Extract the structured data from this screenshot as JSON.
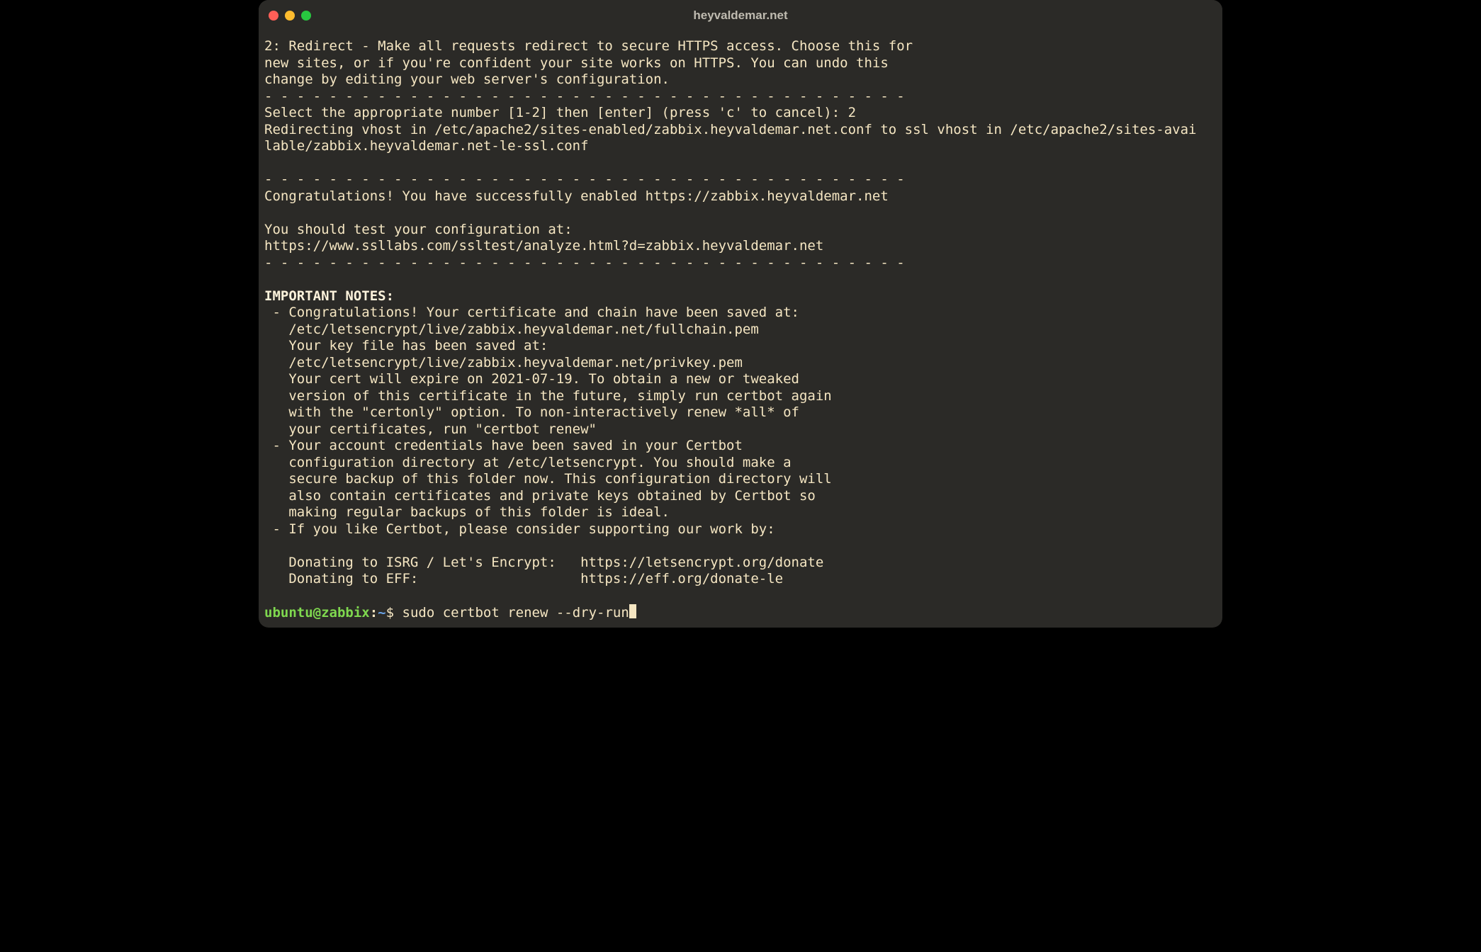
{
  "window": {
    "title": "heyvaldemar.net"
  },
  "output": {
    "l1": "2: Redirect - Make all requests redirect to secure HTTPS access. Choose this for",
    "l2": "new sites, or if you're confident your site works on HTTPS. You can undo this",
    "l3": "change by editing your web server's configuration.",
    "dash1": "- - - - - - - - - - - - - - - - - - - - - - - - - - - - - - - - - - - - - - - -",
    "l4": "Select the appropriate number [1-2] then [enter] (press 'c' to cancel): 2",
    "l5": "Redirecting vhost in /etc/apache2/sites-enabled/zabbix.heyvaldemar.net.conf to ssl vhost in /etc/apache2/sites-avai",
    "l6": "lable/zabbix.heyvaldemar.net-le-ssl.conf",
    "blank1": "",
    "dash2": "- - - - - - - - - - - - - - - - - - - - - - - - - - - - - - - - - - - - - - - -",
    "l7": "Congratulations! You have successfully enabled https://zabbix.heyvaldemar.net",
    "blank2": "",
    "l8": "You should test your configuration at:",
    "l9": "https://www.ssllabs.com/ssltest/analyze.html?d=zabbix.heyvaldemar.net",
    "dash3": "- - - - - - - - - - - - - - - - - - - - - - - - - - - - - - - - - - - - - - - -",
    "blank3": "",
    "l10": "IMPORTANT NOTES:",
    "l11": " - Congratulations! Your certificate and chain have been saved at:",
    "l12": "   /etc/letsencrypt/live/zabbix.heyvaldemar.net/fullchain.pem",
    "l13": "   Your key file has been saved at:",
    "l14": "   /etc/letsencrypt/live/zabbix.heyvaldemar.net/privkey.pem",
    "l15": "   Your cert will expire on 2021-07-19. To obtain a new or tweaked",
    "l16": "   version of this certificate in the future, simply run certbot again",
    "l17": "   with the \"certonly\" option. To non-interactively renew *all* of",
    "l18": "   your certificates, run \"certbot renew\"",
    "l19": " - Your account credentials have been saved in your Certbot",
    "l20": "   configuration directory at /etc/letsencrypt. You should make a",
    "l21": "   secure backup of this folder now. This configuration directory will",
    "l22": "   also contain certificates and private keys obtained by Certbot so",
    "l23": "   making regular backups of this folder is ideal.",
    "l24": " - If you like Certbot, please consider supporting our work by:",
    "blank4": "",
    "l25": "   Donating to ISRG / Let's Encrypt:   https://letsencrypt.org/donate",
    "l26": "   Donating to EFF:                    https://eff.org/donate-le",
    "blank5": ""
  },
  "prompt": {
    "userhost": "ubuntu@zabbix",
    "colon": ":",
    "path": "~",
    "dollar": "$ ",
    "command": "sudo certbot renew --dry-run"
  }
}
